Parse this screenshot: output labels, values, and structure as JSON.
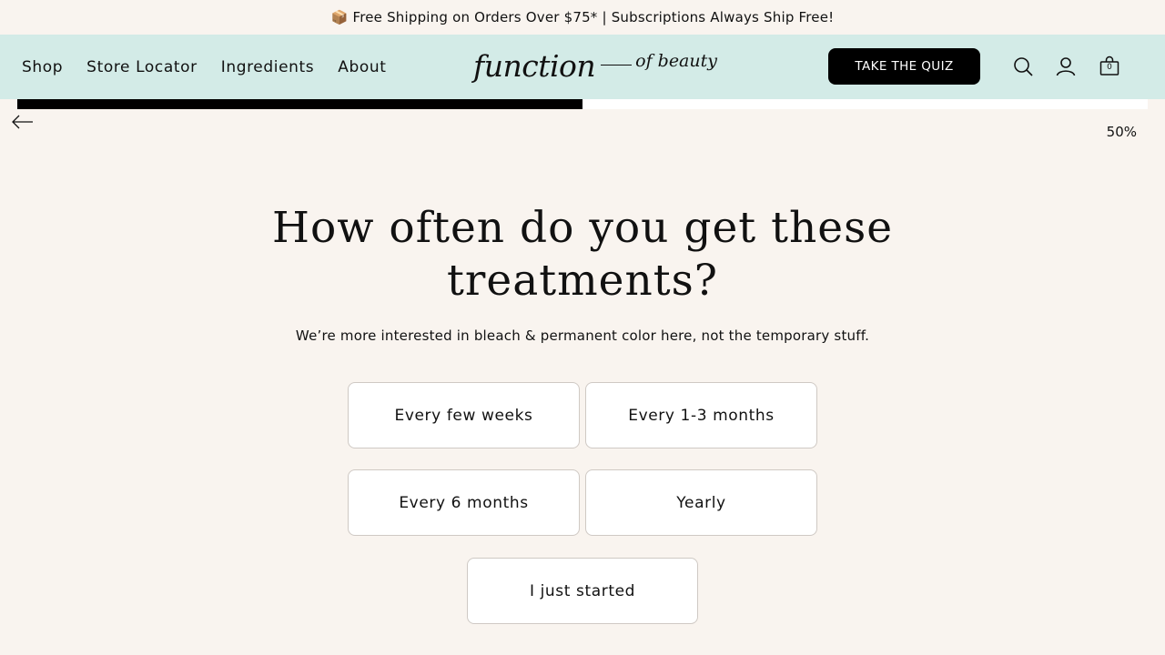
{
  "announcement": "📦 Free Shipping on Orders Over $75* | Subscriptions Always Ship Free!",
  "nav": {
    "items": [
      {
        "label": "Shop"
      },
      {
        "label": "Store Locator"
      },
      {
        "label": "Ingredients"
      },
      {
        "label": "About"
      }
    ]
  },
  "logo": {
    "main": "function",
    "secondary": "of beauty"
  },
  "header": {
    "quiz_button": "TAKE THE QUIZ",
    "icons": [
      "search-icon",
      "account-icon",
      "cart-icon"
    ],
    "cart_count": "0"
  },
  "progress": {
    "value": 0.5,
    "label": "50%"
  },
  "quiz": {
    "question_line1": "How often do you get these",
    "question_line2": "treatments?",
    "subtitle": "We’re more interested in bleach & permanent color here, not the temporary stuff.",
    "options": [
      {
        "label": "Every few weeks"
      },
      {
        "label": "Every 1-3 months"
      },
      {
        "label": "Every 6 months"
      },
      {
        "label": "Yearly"
      },
      {
        "label": "I just started"
      }
    ]
  },
  "colors": {
    "header_bg": "#d3ebe7",
    "page_bg": "#f9f4ef",
    "accent": "#000000"
  }
}
